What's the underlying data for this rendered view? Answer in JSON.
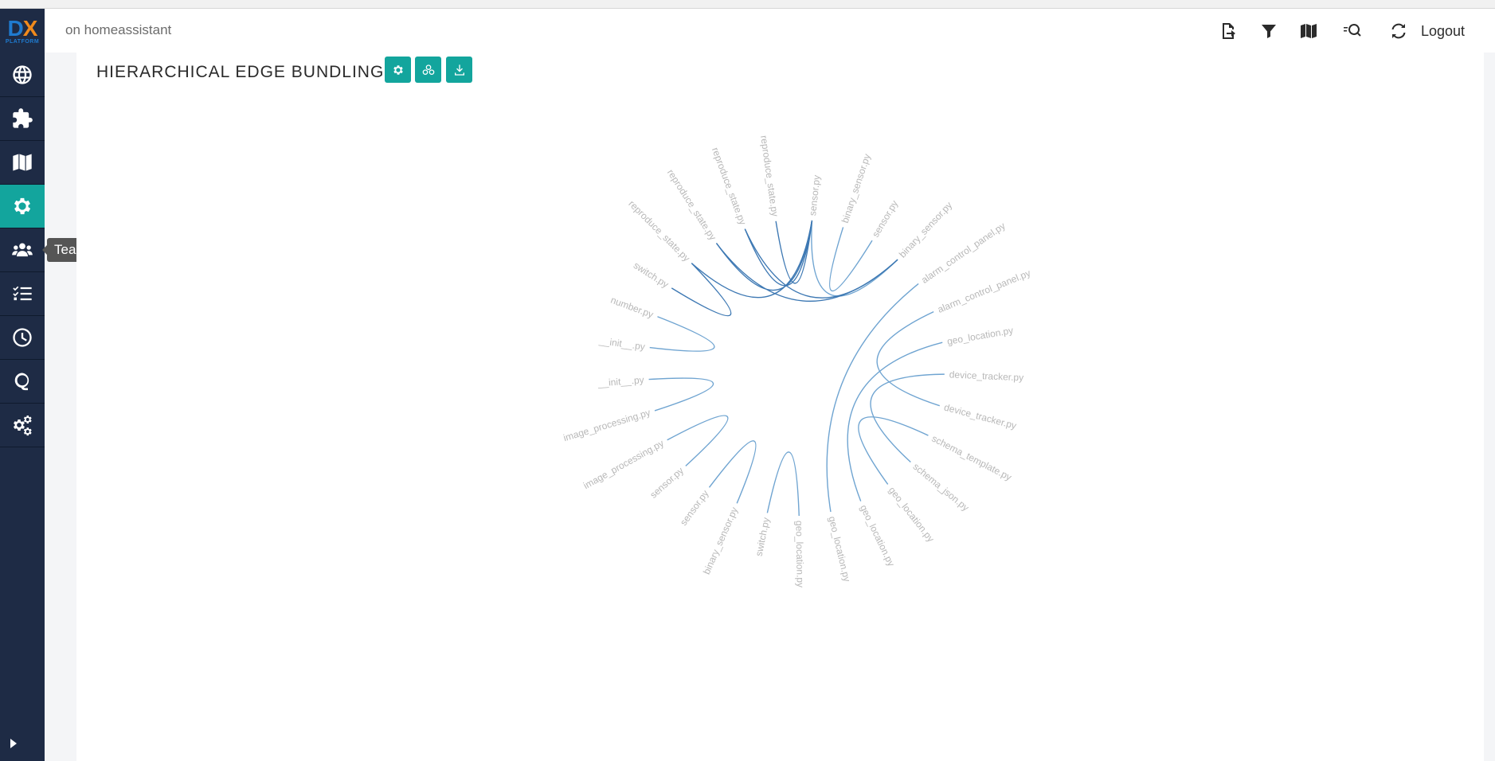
{
  "header": {
    "project_text": "on homeassistant",
    "logout_label": "Logout",
    "icons": [
      "export-icon",
      "filter-icon",
      "map-icon",
      "zoom-search-icon",
      "refresh-icon"
    ]
  },
  "logo": {
    "d": "D",
    "x": "X",
    "sub": "PLATFORM"
  },
  "sidebar": {
    "items": [
      {
        "name": "globe-icon"
      },
      {
        "name": "puzzle-icon"
      },
      {
        "name": "map-icon"
      },
      {
        "name": "settings-gear-icon",
        "active": true
      },
      {
        "name": "team-icon"
      },
      {
        "name": "checklist-icon"
      },
      {
        "name": "clock-icon"
      },
      {
        "name": "q-icon"
      },
      {
        "name": "gears-icon"
      }
    ],
    "tooltip": "Team"
  },
  "page": {
    "title": "HIERARCHICAL EDGE BUNDLING",
    "buttons": [
      "settings-button",
      "cluster-button",
      "download-button"
    ]
  },
  "chart_data": {
    "type": "hierarchical-edge-bundling",
    "accent": "#6fa4d1",
    "accent_dark": "#3d78b3",
    "nodes": [
      "sensor.py",
      "binary_sensor.py",
      "sensor.py",
      "binary_sensor.py",
      "alarm_control_panel.py",
      "alarm_control_panel.py",
      "geo_location.py",
      "device_tracker.py",
      "device_tracker.py",
      "schema_template.py",
      "schema_json.py",
      "geo_location.py",
      "geo_location.py",
      "geo_location.py",
      "geo_location.py",
      "switch.py",
      "binary_sensor.py",
      "sensor.py",
      "sensor.py",
      "image_processing.py",
      "image_processing.py",
      "__init__.py",
      "__init__.py",
      "number.py",
      "switch.py",
      "reproduce_state.py",
      "reproduce_state.py",
      "reproduce_state.py",
      "reproduce_state.py"
    ],
    "edges": [
      [
        0,
        3
      ],
      [
        1,
        2
      ],
      [
        4,
        13
      ],
      [
        5,
        8
      ],
      [
        6,
        12
      ],
      [
        7,
        10
      ],
      [
        9,
        11
      ],
      [
        14,
        15
      ],
      [
        16,
        17
      ],
      [
        18,
        19
      ],
      [
        20,
        21
      ],
      [
        22,
        23
      ],
      [
        24,
        25
      ],
      [
        25,
        0
      ],
      [
        26,
        0
      ],
      [
        27,
        0
      ],
      [
        28,
        0
      ],
      [
        26,
        3
      ],
      [
        27,
        3
      ]
    ],
    "dark_edges": [
      25,
      26,
      27,
      28
    ]
  }
}
